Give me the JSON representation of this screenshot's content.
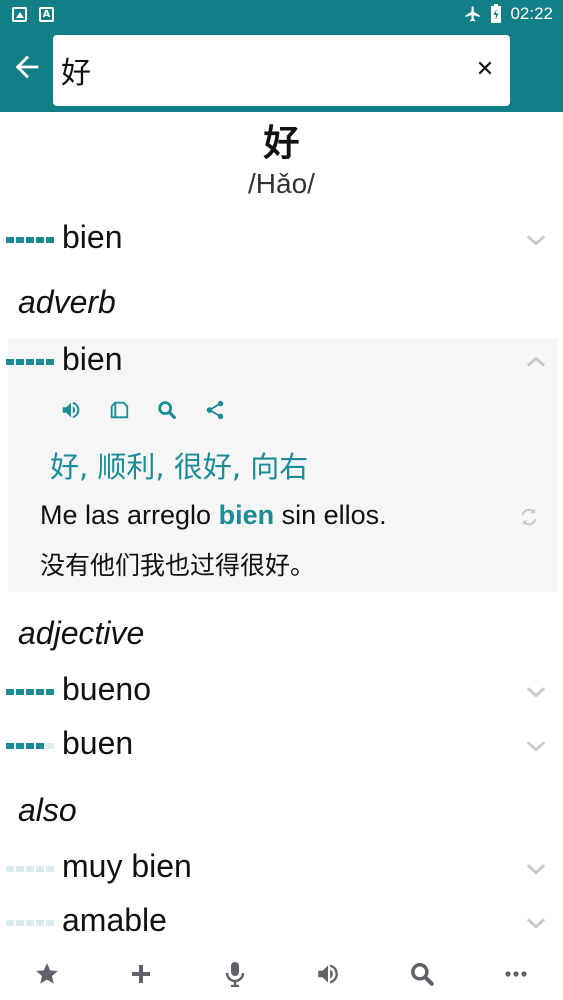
{
  "status_bar": {
    "time": "02:22"
  },
  "search": {
    "value": "好"
  },
  "entry": {
    "headword": "好",
    "pinyin": "/Hǎo/"
  },
  "top_translation": {
    "word": "bien",
    "frequency": 4
  },
  "groups": [
    {
      "pos": "adverb",
      "items": [
        {
          "word": "bien",
          "frequency": 4,
          "expanded": true,
          "back_translations": "好, 顺利, 很好, 向右",
          "example": {
            "before": "Me las arreglo ",
            "highlight": "bien",
            "after": " sin ellos."
          },
          "example_translation": "没有他们我也过得很好。"
        }
      ]
    },
    {
      "pos": "adjective",
      "items": [
        {
          "word": "bueno",
          "frequency": 4
        },
        {
          "word": "buen",
          "frequency": 3
        }
      ]
    },
    {
      "pos": "also",
      "items": [
        {
          "word": "muy bien",
          "frequency": 0
        },
        {
          "word": "amable",
          "frequency": 0
        }
      ]
    }
  ],
  "bottom_nav": [
    "star-icon",
    "plus-icon",
    "microphone-icon",
    "speaker-icon",
    "search-icon",
    "more-icon"
  ],
  "colors": {
    "primary": "#127f87",
    "accent": "#1a8c96",
    "icon_gray": "#5f6368"
  }
}
